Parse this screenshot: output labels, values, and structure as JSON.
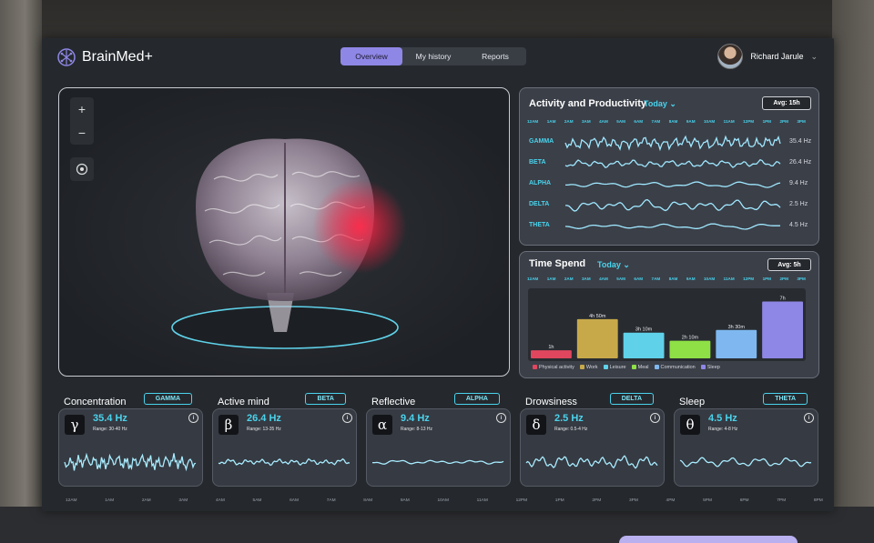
{
  "header": {
    "app_name": "BrainMed+",
    "tabs": [
      {
        "label": "Overview",
        "active": true
      },
      {
        "label": "My history",
        "active": false
      },
      {
        "label": "Reports",
        "active": false
      }
    ],
    "user_name": "Richard Jarule"
  },
  "viewer": {
    "zoom_in": "+",
    "zoom_out": "−",
    "center_icon": "target-icon"
  },
  "activity": {
    "title": "Activity and Productivity",
    "period": "Today",
    "avg": "Avg: 15h",
    "times": [
      "12AM",
      "1AM",
      "2AM",
      "3AM",
      "4AM",
      "5AM",
      "6AM",
      "7AM",
      "8AM",
      "9AM",
      "10AM",
      "11AM",
      "12PM",
      "1PM",
      "2PM",
      "3PM"
    ],
    "waves": [
      {
        "name": "GAMMA",
        "hz": "35.4 Hz"
      },
      {
        "name": "BETA",
        "hz": "26.4 Hz"
      },
      {
        "name": "ALPHA",
        "hz": "9.4 Hz"
      },
      {
        "name": "DELTA",
        "hz": "2.5 Hz"
      },
      {
        "name": "THETA",
        "hz": "4.5 Hz"
      }
    ]
  },
  "time_spend": {
    "title": "Time Spend",
    "period": "Today",
    "avg": "Avg: 5h",
    "times": [
      "12AM",
      "1AM",
      "2AM",
      "3AM",
      "4AM",
      "5AM",
      "6AM",
      "7AM",
      "8AM",
      "9AM",
      "10AM",
      "11AM",
      "12PM",
      "1PM",
      "2PM",
      "3PM"
    ],
    "chart_data": {
      "type": "bar",
      "categories": [
        "Physical activity",
        "Work",
        "Leisure",
        "Meal",
        "Communication",
        "Sleep"
      ],
      "values": [
        1,
        4.83,
        3.17,
        2.17,
        3.5,
        7
      ],
      "data_labels": [
        "1h",
        "4h 50m",
        "3h 10m",
        "2h 10m",
        "3h 30m",
        "7h"
      ],
      "colors": [
        "#e0475e",
        "#c8a94a",
        "#5fd2ea",
        "#8fe046",
        "#7fb8f0",
        "#8f87e6"
      ]
    },
    "legend": [
      "Physical activity",
      "Work",
      "Leisure",
      "Meal",
      "Communication",
      "Sleep"
    ]
  },
  "wave_cards": [
    {
      "title": "Concentration",
      "badge": "GAMMA",
      "symbol": "γ",
      "hz": "35.4 Hz",
      "range": "Range: 30-40 Hz"
    },
    {
      "title": "Active mind",
      "badge": "BETA",
      "symbol": "β",
      "hz": "26.4 Hz",
      "range": "Range: 13-35 Hz"
    },
    {
      "title": "Reflective",
      "badge": "ALPHA",
      "symbol": "α",
      "hz": "9.4 Hz",
      "range": "Range: 8-13 Hz"
    },
    {
      "title": "Drowsiness",
      "badge": "DELTA",
      "symbol": "δ",
      "hz": "2.5 Hz",
      "range": "Range: 0.5-4 Hz"
    },
    {
      "title": "Sleep",
      "badge": "THETA",
      "symbol": "θ",
      "hz": "4.5 Hz",
      "range": "Range: 4-8 Hz"
    }
  ],
  "info_glyph": "i",
  "bottom_times": [
    "12AM",
    "1AM",
    "2AM",
    "3AM",
    "4AM",
    "5AM",
    "6AM",
    "7AM",
    "8AM",
    "9AM",
    "10AM",
    "11AM",
    "12PM",
    "1PM",
    "2PM",
    "3PM",
    "4PM",
    "5PM",
    "6PM",
    "7PM",
    "8PM"
  ],
  "colors": {
    "accent": "#8f87e6",
    "cyan": "#4ad3ec",
    "panel": "#25292e"
  }
}
